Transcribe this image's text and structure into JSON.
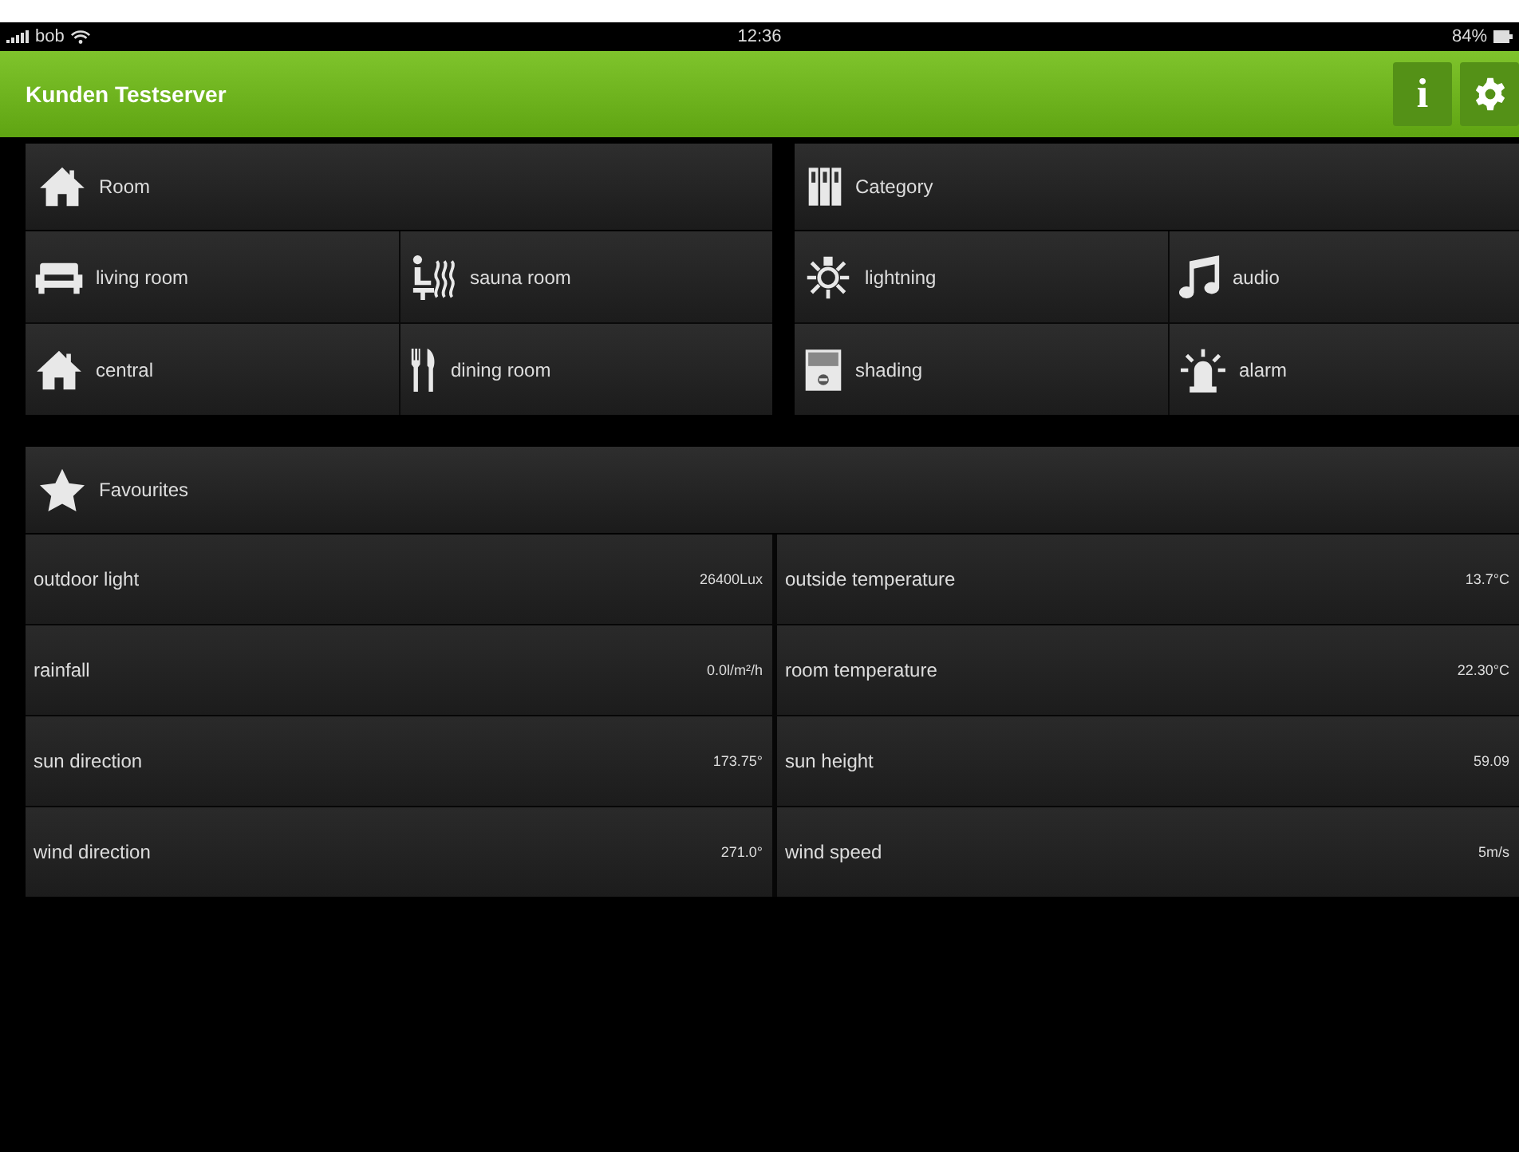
{
  "status_bar": {
    "carrier": "bob",
    "time": "12:36",
    "battery": "84%"
  },
  "header": {
    "title": "Kunden Testserver",
    "buttons": [
      {
        "kind": "info",
        "label": "i"
      },
      {
        "kind": "gear"
      }
    ]
  },
  "panels": [
    {
      "title": "Room",
      "kind": "house",
      "items": [
        {
          "label": "living room",
          "kind": "sofa"
        },
        {
          "label": "sauna room",
          "kind": "sauna"
        },
        {
          "label": "central",
          "kind": "house"
        },
        {
          "label": "dining room",
          "kind": "cutlery"
        }
      ]
    },
    {
      "title": "Category",
      "kind": "binders",
      "items": [
        {
          "label": "lightning",
          "kind": "bulb"
        },
        {
          "label": "audio",
          "kind": "music"
        },
        {
          "label": "shading",
          "kind": "shade"
        },
        {
          "label": "alarm",
          "kind": "alarm"
        }
      ]
    }
  ],
  "favourites": {
    "title": "Favourites",
    "kind": "star",
    "rows": [
      {
        "name": "outdoor light",
        "value": "26400Lux"
      },
      {
        "name": "outside temperature",
        "value": "13.7°C"
      },
      {
        "name": "rainfall",
        "value": "0.0l/m²/h"
      },
      {
        "name": "room temperature",
        "value": "22.30°C"
      },
      {
        "name": "sun direction",
        "value": "173.75°"
      },
      {
        "name": "sun height",
        "value": "59.09"
      },
      {
        "name": "wind direction",
        "value": "271.0°"
      },
      {
        "name": "wind speed",
        "value": "5m/s"
      }
    ]
  }
}
